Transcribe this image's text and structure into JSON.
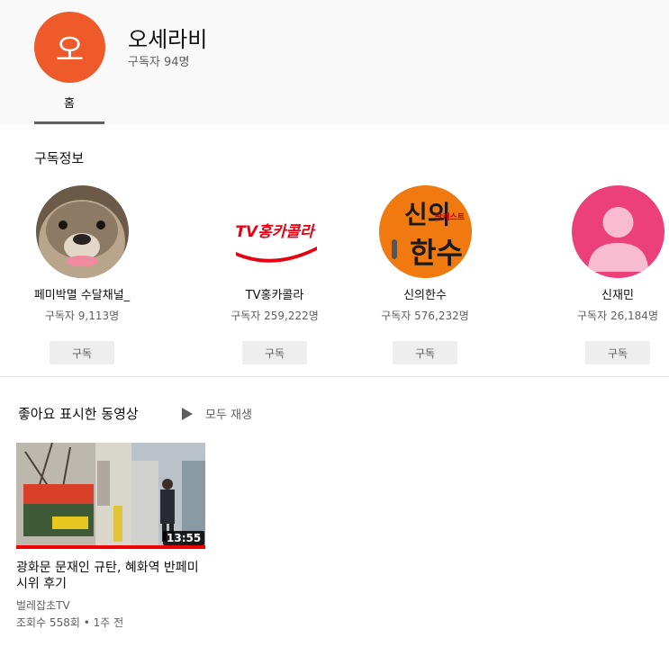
{
  "header": {
    "avatar_letter": "오",
    "channel_name": "오세라비",
    "subscribers": "구독자 94명",
    "tab_home": "홈"
  },
  "subscriptions": {
    "title": "구독정보",
    "items": [
      {
        "name": "페미박멸 수달채널_",
        "count": "구독자 9,113명",
        "button": "구독"
      },
      {
        "name": "TV홍카콜라",
        "count": "구독자 259,222명",
        "button": "구독",
        "logo_text": "TV홍카콜라"
      },
      {
        "name": "신의한수",
        "count": "구독자 576,232명",
        "button": "구독",
        "logo_text_top": "신의",
        "logo_text_bottom": "한수",
        "logo_text_side": "팟캐스트"
      },
      {
        "name": "신재민",
        "count": "구독자 26,184명",
        "button": "구독"
      }
    ]
  },
  "liked": {
    "title": "좋아요 표시한 동영상",
    "play_all": "모두 재생",
    "video": {
      "duration": "13:55",
      "title": "광화문 문재인 규탄, 혜화역 반페미 시위 후기",
      "channel": "벌레잡초TV",
      "meta": "조회수 558회 • 1주 전"
    }
  },
  "colors": {
    "avatar_main": "#ef5a2b",
    "hongcola_red": "#e60012",
    "sinui_orange": "#f07a10",
    "default_avatar_pink": "#ec407a"
  }
}
